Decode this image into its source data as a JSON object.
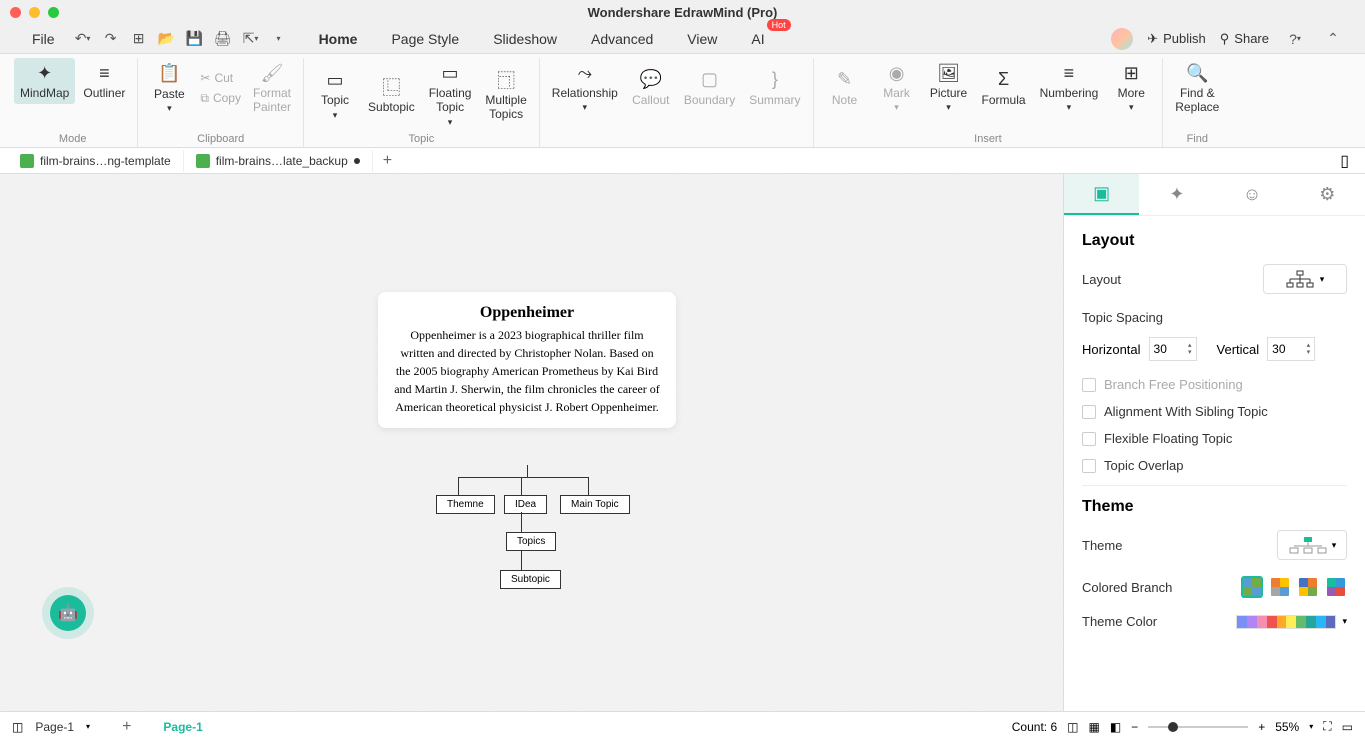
{
  "app": {
    "title": "Wondershare EdrawMind (Pro)"
  },
  "menubar": {
    "file": "File",
    "tabs": [
      "Home",
      "Page Style",
      "Slideshow",
      "Advanced",
      "View",
      "AI"
    ],
    "active_tab": "Home",
    "hot_badge": "Hot",
    "publish": "Publish",
    "share": "Share"
  },
  "ribbon": {
    "mode": {
      "mindmap": "MindMap",
      "outliner": "Outliner",
      "label": "Mode"
    },
    "clipboard": {
      "paste": "Paste",
      "cut": "Cut",
      "copy": "Copy",
      "format_painter": "Format\nPainter",
      "label": "Clipboard"
    },
    "topic": {
      "topic": "Topic",
      "subtopic": "Subtopic",
      "floating": "Floating\nTopic",
      "multiple": "Multiple\nTopics",
      "label": "Topic"
    },
    "relationship": "Relationship",
    "callout": "Callout",
    "boundary": "Boundary",
    "summary": "Summary",
    "insert": {
      "note": "Note",
      "mark": "Mark",
      "picture": "Picture",
      "formula": "Formula",
      "numbering": "Numbering",
      "more": "More",
      "label": "Insert"
    },
    "find": {
      "find_replace": "Find &\nReplace",
      "label": "Find"
    }
  },
  "doc_tabs": [
    {
      "label": "film-brains…ng-template",
      "modified": false
    },
    {
      "label": "film-brains…late_backup",
      "modified": true
    }
  ],
  "canvas": {
    "main_title": "Oppenheimer",
    "main_desc": "Oppenheimer is a 2023 biographical thriller film written and directed by Christopher Nolan. Based on the 2005 biography American Prometheus by Kai Bird and Martin J. Sherwin, the film chronicles the career of American theoretical physicist J. Robert Oppenheimer.",
    "children": [
      "Themne",
      "IDea",
      "Main Topic"
    ],
    "sub1": "Topics",
    "sub2": "Subtopic"
  },
  "right_panel": {
    "layout_heading": "Layout",
    "layout_label": "Layout",
    "topic_spacing": "Topic Spacing",
    "horizontal": "Horizontal",
    "horizontal_value": "30",
    "vertical": "Vertical",
    "vertical_value": "30",
    "branch_free": "Branch Free Positioning",
    "alignment": "Alignment With Sibling Topic",
    "flexible": "Flexible Floating Topic",
    "overlap": "Topic Overlap",
    "theme_heading": "Theme",
    "theme_label": "Theme",
    "colored_branch": "Colored Branch",
    "theme_color": "Theme Color"
  },
  "statusbar": {
    "page1": "Page-1",
    "page_active": "Page-1",
    "count": "Count: 6",
    "zoom": "55%"
  }
}
